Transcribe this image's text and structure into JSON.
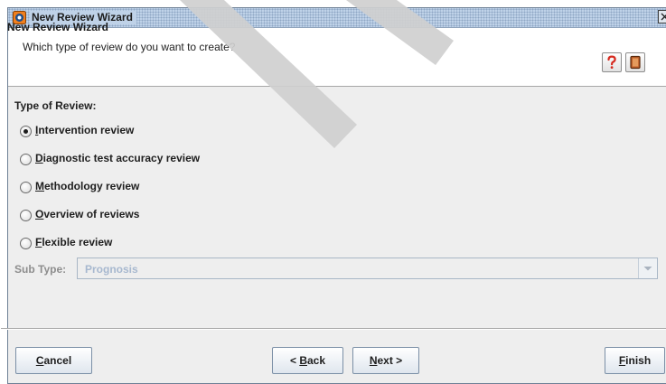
{
  "window": {
    "title": "New Review Wizard"
  },
  "header": {
    "title": "New Review Wizard",
    "subtitle": "Which type of review do you want to create?",
    "help_icon": "question-mark-icon",
    "book_icon": "book-icon"
  },
  "review_type": {
    "label": "Type of Review:",
    "selected": "Intervention review",
    "options": [
      {
        "mnemonic": "I",
        "rest": "ntervention review",
        "checked": true
      },
      {
        "mnemonic": "D",
        "rest": "iagnostic test accuracy review",
        "checked": false
      },
      {
        "mnemonic": "M",
        "rest": "ethodology review",
        "checked": false
      },
      {
        "mnemonic": "O",
        "rest": "verview of reviews",
        "checked": false
      },
      {
        "mnemonic": "F",
        "rest": "lexible review",
        "checked": false
      }
    ]
  },
  "sub_type": {
    "label": "Sub Type:",
    "value": "Prognosis",
    "enabled": false
  },
  "buttons": {
    "cancel": {
      "mnemonic": "C",
      "rest": "ancel"
    },
    "back": {
      "prefix": "< ",
      "mnemonic": "B",
      "rest": "ack"
    },
    "next": {
      "mnemonic": "N",
      "rest": "ext >"
    },
    "finish": {
      "mnemonic": "F",
      "rest": "inish"
    }
  },
  "colors": {
    "titlebar": "#bfd2e8",
    "accent_border": "#7b8fa6",
    "disabled_text": "#a7b8cf",
    "help_icon": "#d62a1f",
    "book_icon": "#c0602a"
  }
}
